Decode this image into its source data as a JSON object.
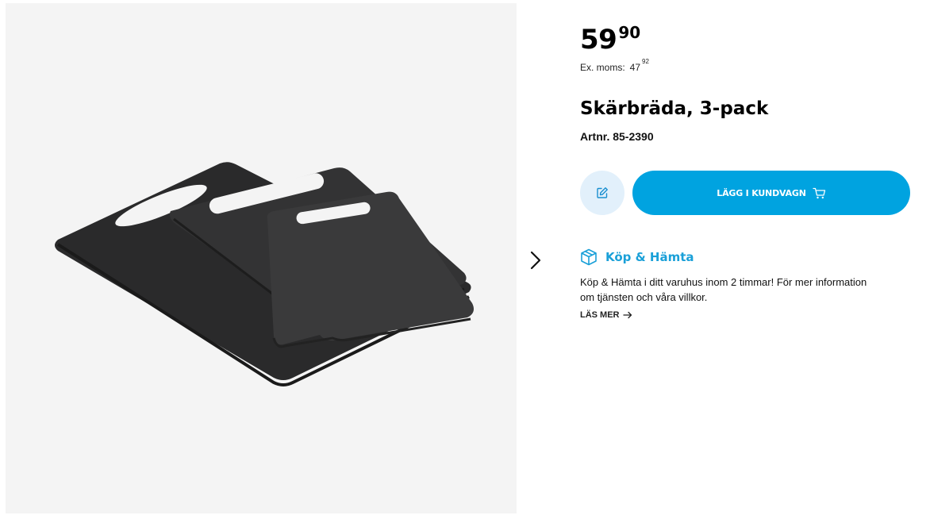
{
  "product": {
    "image_alt": "Skärbräda, 3-pack",
    "price_int": "59",
    "price_dec": "90",
    "ex_moms_label": "Ex. moms:",
    "ex_moms_int": "47",
    "ex_moms_dec": "92",
    "title": "Skärbräda, 3-pack",
    "article_number": "Artnr. 85-2390"
  },
  "actions": {
    "edit_icon": "pencil-square-icon",
    "add_to_cart_label": "LÄGG I KUNDVAGN",
    "cart_icon": "cart-icon"
  },
  "pickup": {
    "icon": "box-icon",
    "title": "Köp & Hämta",
    "description": "Köp & Hämta i ditt varuhus inom 2 timmar! För mer information om tjänsten och våra villkor.",
    "read_more_label": "LÄS MER",
    "read_more_icon": "arrow-right-icon"
  },
  "gallery": {
    "next_icon": "chevron-right-icon"
  },
  "colors": {
    "accent": "#00a3e0",
    "accent_text": "#1aa0d8",
    "edit_bg": "#e2f0fb",
    "image_bg": "#f4f4f4"
  }
}
